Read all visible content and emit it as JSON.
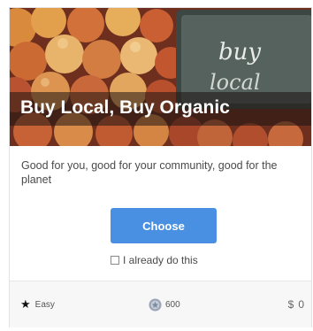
{
  "card": {
    "title": "Buy Local, Buy Organic",
    "description": "Good for you, good for your community, good for the planet",
    "sign_text_line1": "buy",
    "sign_text_line2": "local",
    "choose_label": "Choose",
    "already_label": "I already do this",
    "footer": {
      "difficulty_icon": "star-icon",
      "difficulty": "Easy",
      "points_icon": "points-badge-icon",
      "points": "600",
      "cost_symbol": "$",
      "cost": "0"
    }
  },
  "colors": {
    "button": "#4a90e2",
    "footer_bg": "#f7f7f7",
    "title_band": "#1e1412"
  }
}
